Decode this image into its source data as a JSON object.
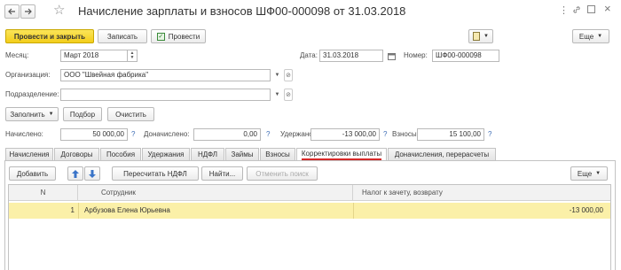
{
  "header": {
    "title": "Начисление зарплаты и взносов ШФ00-000098 от 31.03.2018",
    "back_icon": "arrow-left-icon",
    "forward_icon": "arrow-right-icon",
    "favorite_icon": "star-icon",
    "more_icon": "dots-vertical-icon",
    "link_icon": "link-icon",
    "expand_icon": "expand-icon",
    "close_icon": "close-icon"
  },
  "toolbar": {
    "post_close_label": "Провести и закрыть",
    "save_label": "Записать",
    "post_label": "Провести",
    "more_label": "Еще"
  },
  "form": {
    "month_label": "Месяц:",
    "month_value": "Март 2018",
    "date_label": "Дата:",
    "date_value": "31.03.2018",
    "number_label": "Номер:",
    "number_value": "ШФ00-000098",
    "org_label": "Организация:",
    "org_value": "ООО \"Швейная фабрика\"",
    "dept_label": "Подразделение:",
    "dept_value": "",
    "fill_label": "Заполнить",
    "select_label": "Подбор",
    "clear_label": "Очистить",
    "accrued_label": "Начислено:",
    "accrued_value": "50 000,00",
    "additional_label": "Доначислено:",
    "additional_value": "0,00",
    "withheld_label": "Удержано:",
    "withheld_value": "-13 000,00",
    "contrib_label": "Взносы:",
    "contrib_value": "15 100,00",
    "question_mark": "?"
  },
  "tabs": [
    {
      "label": "Начисления"
    },
    {
      "label": "Договоры"
    },
    {
      "label": "Пособия"
    },
    {
      "label": "Удержания"
    },
    {
      "label": "НДФЛ"
    },
    {
      "label": "Займы"
    },
    {
      "label": "Взносы"
    },
    {
      "label": "Корректировки выплаты"
    },
    {
      "label": "Доначисления, перерасчеты"
    }
  ],
  "panel": {
    "add_label": "Добавить",
    "recalc_label": "Пересчитать НДФЛ",
    "find_label": "Найти...",
    "cancel_search_label": "Отменить поиск",
    "more_label": "Еще"
  },
  "table": {
    "columns": [
      "N",
      "Сотрудник",
      "Налог к зачету, возврату"
    ],
    "rows": [
      {
        "n": "1",
        "employee": "Арбузова Елена Юрьевна",
        "amount": "-13 000,00"
      }
    ]
  },
  "colors": {
    "accent_yellow": "#f5d32a",
    "selected_row": "#fbf0a8",
    "tab_underline": "#d62828"
  }
}
